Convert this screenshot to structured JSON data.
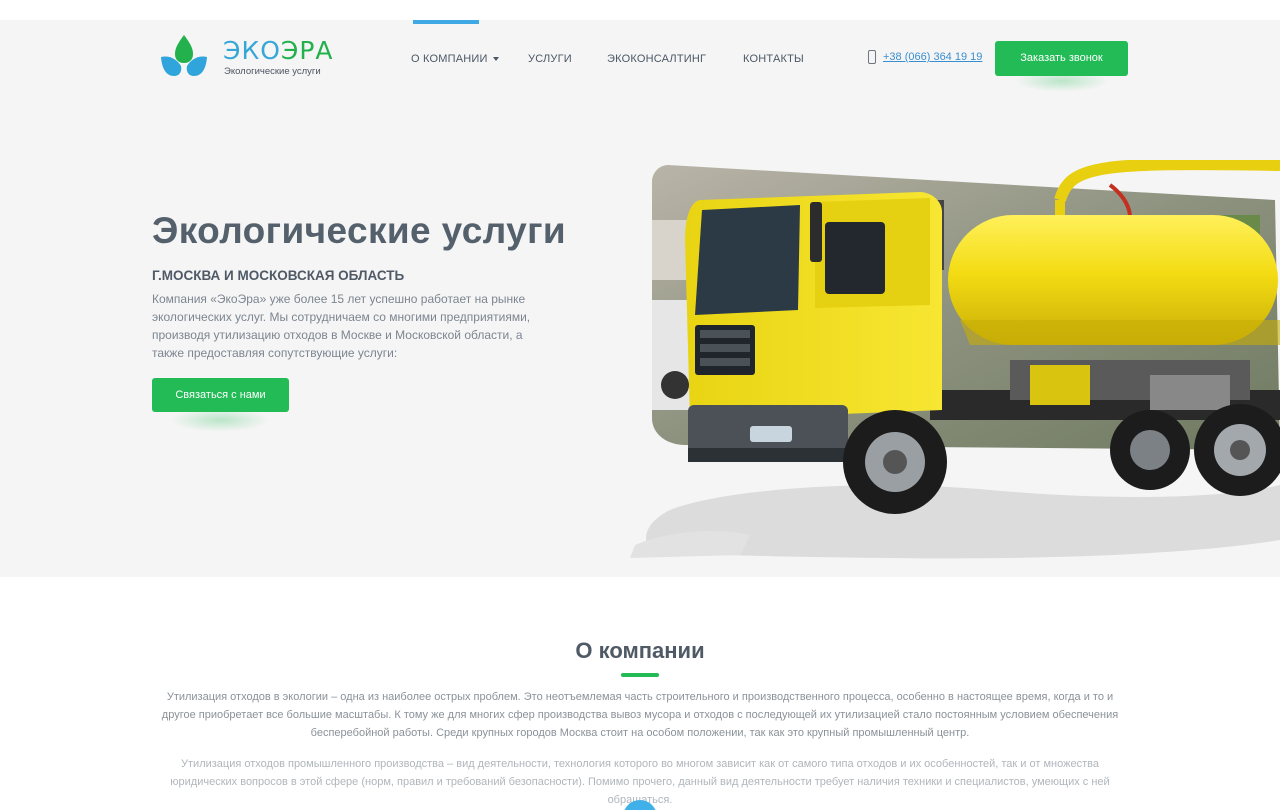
{
  "header": {
    "logo": {
      "name_part1": "ЭКО",
      "name_part2": "ЭРА",
      "subtitle": "Экологические услуги"
    },
    "nav": [
      {
        "label": "О КОМПАНИИ",
        "has_dropdown": true,
        "active": true
      },
      {
        "label": "УСЛУГИ"
      },
      {
        "label": "ЭКОКОНСАЛТИНГ"
      },
      {
        "label": "КОНТАКТЫ"
      }
    ],
    "phone": "+38 (066) 364 19 19",
    "call_button": "Заказать звонок"
  },
  "hero": {
    "title": "Экологические услуги",
    "subtitle": "Г.МОСКВА И МОСКОВСКАЯ ОБЛАСТЬ",
    "description": "Компания «ЭкоЭра» уже более 15 лет успешно работает на рынке экологических услуг. Мы сотрудничаем со многими предприятиями, производя утилизацию отходов в Москве и Московской области, а также предоставляя сопутствующие услуги:",
    "contact_button": "Связаться с нами",
    "image": "yellow-vacuum-truck"
  },
  "about": {
    "title": "О компании",
    "paragraph1": "Утилизация отходов в экологии – одна из наиболее острых проблем. Это неотъемлемая часть строительного и производственного процесса, особенно в настоящее время, когда и то и другое приобретает все большие масштабы. К тому же для многих сфер производства вывоз мусора и отходов с последующей их утилизацией стало постоянным условием обеспечения бесперебойной работы. Среди крупных городов Москва стоит на особом положении, так как это крупный промышленный центр.",
    "paragraph2": "Утилизация отходов промышленного производства – вид деятельности, технология которого во многом зависит как от самого типа отходов и их особенностей, так и от множества юридических вопросов в этой сфере (норм, правил и требований безопасности). Помимо прочего, данный вид деятельности требует наличия техники и специалистов, умеющих с ней обращаться."
  },
  "colors": {
    "accent_green": "#22bb55",
    "accent_blue": "#3fa9e5",
    "hero_bg": "#f5f5f5",
    "truck_yellow": "#f5e21a"
  }
}
